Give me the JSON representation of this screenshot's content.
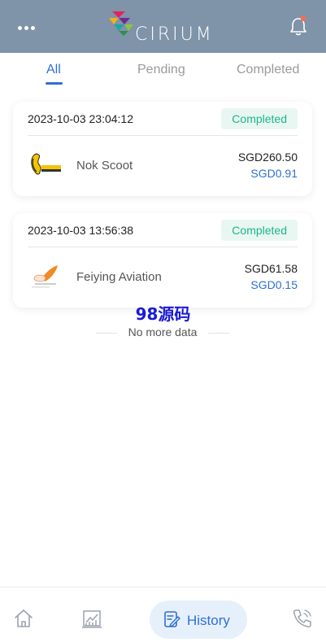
{
  "header": {
    "logo_text": "CIRIUM",
    "menu_icon": "more-dots-icon",
    "notification_icon": "bell-icon",
    "notification_dot_color": "#ff6b4a"
  },
  "tabs": [
    {
      "label": "All",
      "active": true
    },
    {
      "label": "Pending",
      "active": false
    },
    {
      "label": "Completed",
      "active": false
    }
  ],
  "transactions": [
    {
      "datetime": "2023-10-03 23:04:12",
      "status": "Completed",
      "name": "Nok Scoot",
      "amount": "SGD260.50",
      "fee": "SGD0.91"
    },
    {
      "datetime": "2023-10-03 13:56:38",
      "status": "Completed",
      "name": "Feiying Aviation",
      "amount": "SGD61.58",
      "fee": "SGD0.15"
    }
  ],
  "watermark": "98源码",
  "list_end_text": "No more data",
  "bottom_nav": {
    "history_label": "History",
    "active": "History"
  },
  "colors": {
    "header_bg": "#7f93a9",
    "accent": "#2f6fd6",
    "status_completed": "#1fb48a"
  }
}
